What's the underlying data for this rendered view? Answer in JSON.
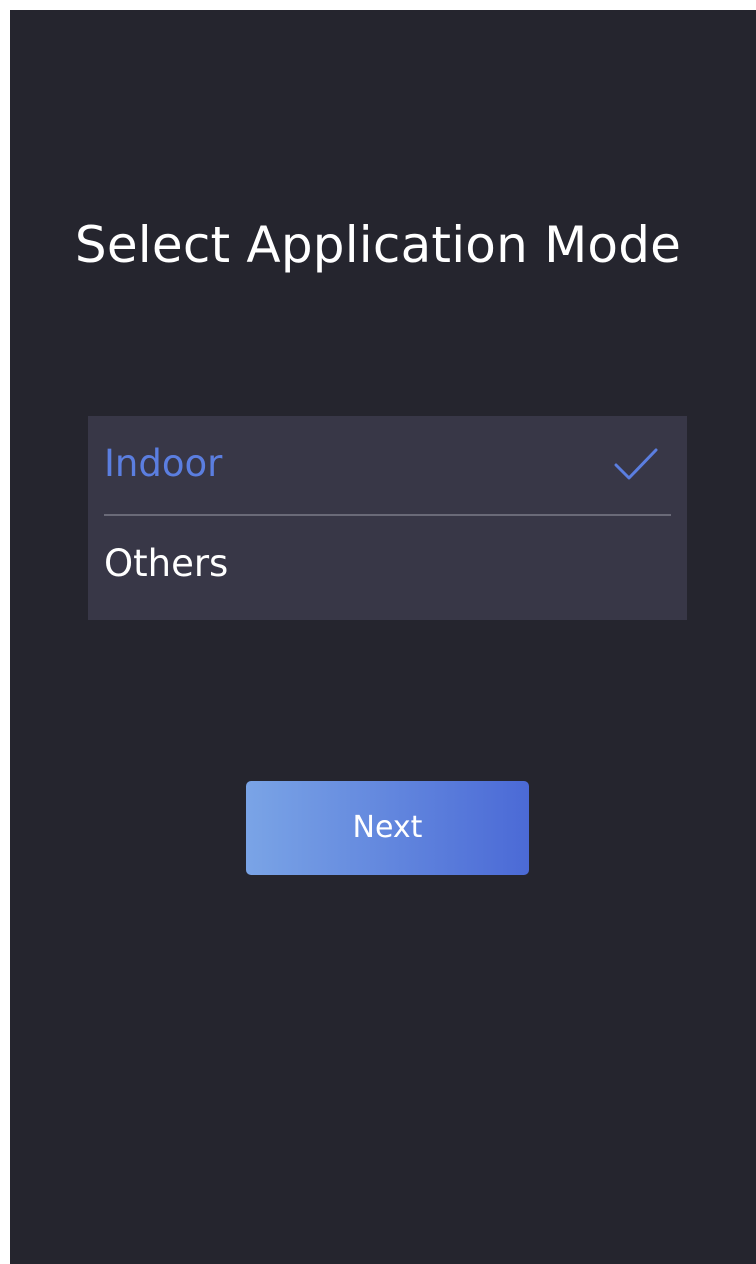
{
  "screen": {
    "title": "Select Application Mode"
  },
  "mode_list": {
    "options": [
      {
        "label": "Indoor",
        "selected": true,
        "icon": "check-icon"
      },
      {
        "label": "Others",
        "selected": false
      }
    ]
  },
  "actions": {
    "next_label": "Next"
  },
  "colors": {
    "background": "#25252e",
    "panel": "#383747",
    "accent": "#5b7ee0",
    "button_gradient_start": "#7aa4e6",
    "button_gradient_end": "#4b6ad6"
  }
}
